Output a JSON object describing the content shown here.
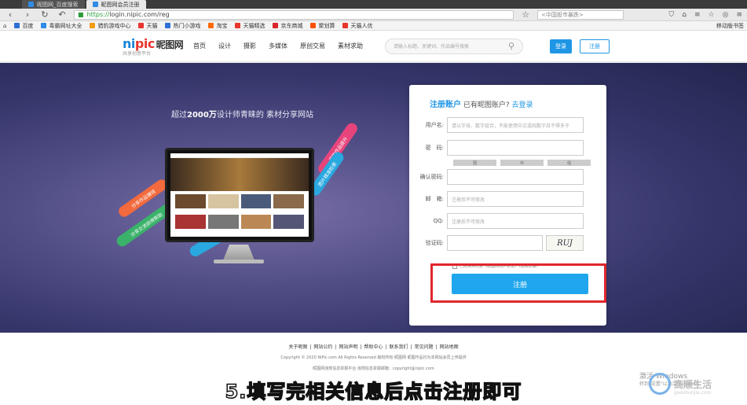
{
  "browser": {
    "tabs": [
      {
        "label": "昵图网_百度搜索",
        "active": false
      },
      {
        "label": "昵图网会员注册",
        "active": true
      }
    ],
    "address": {
      "scheme": "https://",
      "url": "login.nipic.com/reg"
    },
    "search_placeholder": "<中国股市暴跌>",
    "bookmarks": [
      {
        "label": "百度",
        "color": "#2f6fd6"
      },
      {
        "label": "毒霸网址大全",
        "color": "#2f8be6"
      },
      {
        "label": "猎豹游戏中心",
        "color": "#f39c12"
      },
      {
        "label": "天猫",
        "color": "#e8352e"
      },
      {
        "label": "热门小游戏",
        "color": "#2f6fd6"
      },
      {
        "label": "淘宝",
        "color": "#ff6a00"
      },
      {
        "label": "天猫精选",
        "color": "#e8352e"
      },
      {
        "label": "京东商城",
        "color": "#d8262c"
      },
      {
        "label": "聚划算",
        "color": "#ff5000"
      },
      {
        "label": "天猫人优",
        "color": "#e8352e"
      }
    ],
    "bookmarks_right": "移动版书签"
  },
  "site": {
    "logo_main_a": "ni",
    "logo_main_b": "pic",
    "logo_cn": "昵图网",
    "logo_sub": "共享创意平台",
    "nav": [
      "首页",
      "设计",
      "摄影",
      "多媒体",
      "原创交易",
      "素材求助"
    ],
    "search_placeholder": "请输入标题、关键词、作品编号搜索",
    "login_label": "登录",
    "register_label": "注册"
  },
  "hero": {
    "title_prefix": "超过",
    "title_bold": "2000万",
    "title_suffix": "设计师青睐的 素材分享网站",
    "ribbons": [
      "分享作品赚钱",
      "分享交流获得帮助",
      "获取作品提升",
      "图片精准检索"
    ]
  },
  "form": {
    "title": "注册账户",
    "has_account": "已有昵图账户?",
    "login_link": "去登录",
    "fields": [
      {
        "label": "用户名:",
        "placeholder": "请以字母、数字组合，不能使用中文或纯数字且不得多于"
      },
      {
        "label": "密　码:",
        "placeholder": ""
      },
      {
        "label": "确认密码:",
        "placeholder": ""
      },
      {
        "label": "邮　箱:",
        "placeholder": "注册后不可修改"
      },
      {
        "label": "QQ:",
        "placeholder": "注册后不可修改"
      }
    ],
    "strength": [
      "弱",
      "中",
      "强"
    ],
    "captcha_label": "验证码:",
    "captcha_text": "RUJ",
    "agree_text": "已阅读并同意《昵图网用户协议》《隐私政策》",
    "submit_label": "注册"
  },
  "footer": {
    "links": [
      "关于昵图",
      "网站公约",
      "网站声明",
      "帮助中心",
      "联系我们",
      "常见问题",
      "网站地图"
    ],
    "copyright": "Copyright © 2020 NiPic.com All Rights Reserved   版权所有·昵图网   昵图作品均为本网站会员上传提供",
    "report": "昵图网违规信息举报平台   违规信息举报邮箱：copyright@nipic.com"
  },
  "overlay": {
    "caption": "5.填写完相关信息后点击注册即可",
    "activate": "激活 Windows",
    "activate_sub": "转到\"设置\"以激活 Windows。",
    "watermark": "髙顺生活",
    "watermark_sub": "gaoshunjia.com"
  }
}
